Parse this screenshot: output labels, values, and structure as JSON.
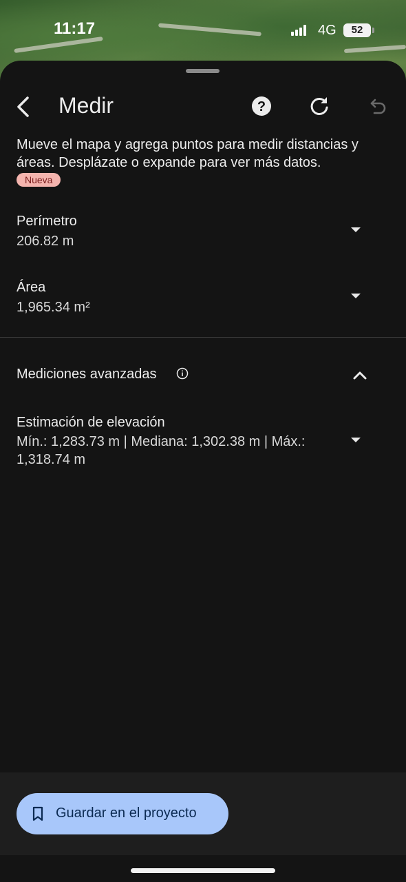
{
  "status_bar": {
    "time": "11:17",
    "network": "4G",
    "battery": "52"
  },
  "header": {
    "title": "Medir",
    "icons": [
      "back-arrow-icon",
      "help-icon",
      "refresh-icon",
      "undo-icon"
    ]
  },
  "description": "Mueve el mapa y agrega puntos para medir distancias y áreas. Desplázate o expande para ver más datos.",
  "badge": "Nueva",
  "measurements": {
    "perimeter": {
      "label": "Perímetro",
      "value": "206.82 m"
    },
    "area": {
      "label": "Área",
      "value": "1,965.34 m²"
    }
  },
  "advanced": {
    "title": "Mediciones avanzadas",
    "elevation": {
      "label": "Estimación de elevación",
      "value": "Mín.: 1,283.73 m | Mediana: 1,302.38 m | Máx.: 1,318.74 m"
    }
  },
  "save_button": {
    "label": "Guardar en el proyecto"
  },
  "colors": {
    "background": "#141414",
    "badge_bg": "#f4b4ae",
    "button_bg": "#a8c7fa",
    "button_text": "#0b2a52"
  }
}
